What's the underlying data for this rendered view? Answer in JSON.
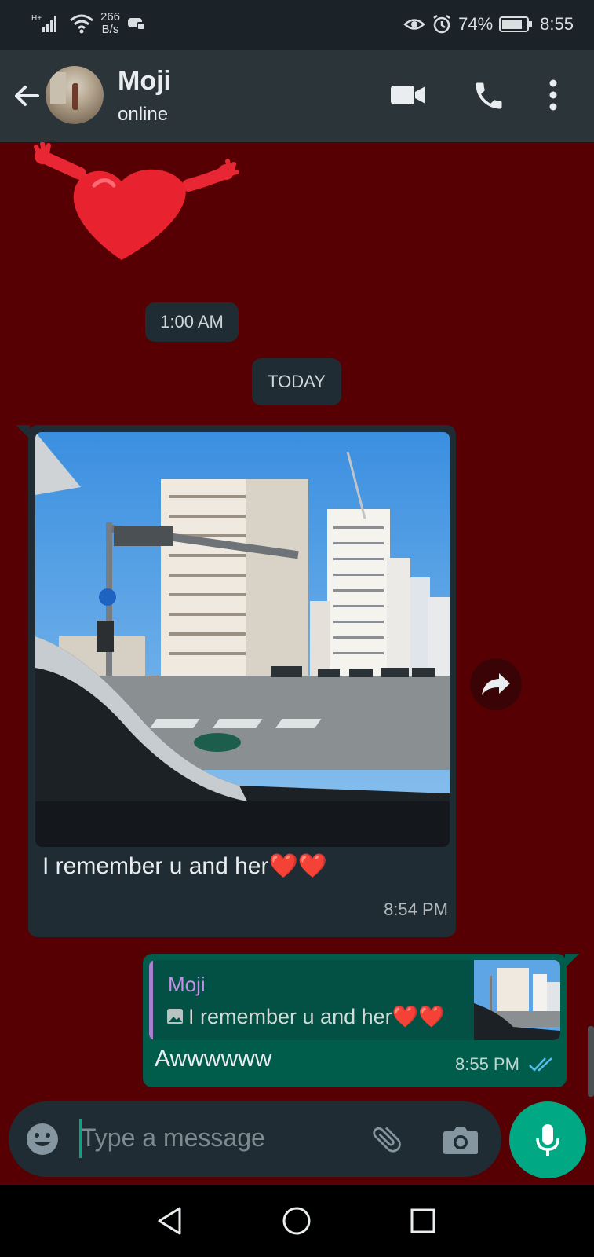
{
  "status_bar": {
    "network_type": "H+",
    "speed_value": "266",
    "speed_unit": "B/s",
    "battery": "74%",
    "time": "8:55"
  },
  "header": {
    "contact_name": "Moji",
    "contact_status": "online",
    "icons": [
      "back-arrow-icon",
      "video-call-icon",
      "voice-call-icon",
      "more-options-icon"
    ]
  },
  "chat": {
    "date_chips": [
      "1:00 AM",
      "TODAY"
    ],
    "incoming": {
      "text": "I remember u and her",
      "emoji": "❤️❤️",
      "time": "8:54 PM"
    },
    "outgoing": {
      "quoted_author": "Moji",
      "quoted_text": "I remember u and her",
      "quoted_emoji": "❤️❤️",
      "text": "Awwwwww",
      "time": "8:55 PM",
      "read_status": "read"
    }
  },
  "composer": {
    "placeholder": "Type a message"
  },
  "colors": {
    "chat_background": "#560003",
    "incoming_bubble": "#1f2c33",
    "outgoing_bubble": "#005c4b",
    "accent": "#00a884",
    "read_ticks": "#53bdeb"
  }
}
